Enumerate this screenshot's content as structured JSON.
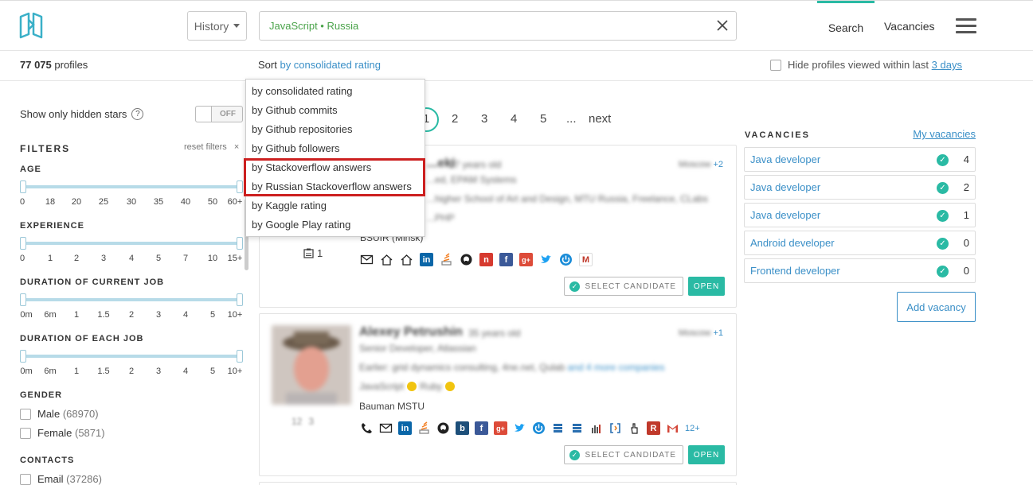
{
  "header": {
    "history_label": "History",
    "search_query": "JavaScript • Russia",
    "nav_search": "Search",
    "nav_vacancies": "Vacancies"
  },
  "subbar": {
    "profiles_count": "77 075",
    "profiles_label": "profiles",
    "sort_prefix": "Sort",
    "sort_value": "by consolidated rating",
    "hide_label": "Hide profiles viewed within last",
    "hide_days": "3 days"
  },
  "sort_menu": {
    "items": [
      "by consolidated rating",
      "by Github commits",
      "by Github repositories",
      "by Github followers",
      "by Stackoverflow answers",
      "by Russian Stackoverflow answers",
      "by Kaggle rating",
      "by Google Play rating"
    ],
    "highlight_color": "#cc1f1f"
  },
  "sidebar": {
    "hidden_stars_label": "Show only hidden stars",
    "help_glyph": "?",
    "toggle_label": "OFF",
    "filters_title": "FILTERS",
    "reset_label": "reset filters",
    "reset_close": "×",
    "age": {
      "title": "AGE",
      "ticks": [
        "0",
        "18",
        "20",
        "25",
        "30",
        "35",
        "40",
        "50",
        "60+"
      ]
    },
    "experience": {
      "title": "EXPERIENCE",
      "ticks": [
        "0",
        "1",
        "2",
        "3",
        "4",
        "5",
        "7",
        "10",
        "15+"
      ]
    },
    "current_job": {
      "title": "DURATION OF CURRENT JOB",
      "ticks": [
        "0m",
        "6m",
        "1",
        "1.5",
        "2",
        "3",
        "4",
        "5",
        "10+"
      ]
    },
    "each_job": {
      "title": "DURATION OF EACH JOB",
      "ticks": [
        "0m",
        "6m",
        "1",
        "1.5",
        "2",
        "3",
        "4",
        "5",
        "10+"
      ]
    },
    "gender": {
      "title": "GENDER",
      "options": [
        {
          "label": "Male",
          "count": "(68970)"
        },
        {
          "label": "Female",
          "count": "(5871)"
        }
      ]
    },
    "contacts": {
      "title": "CONTACTS",
      "options": [
        {
          "label": "Email",
          "count": "(37286)"
        }
      ]
    }
  },
  "pagination": {
    "current": "1",
    "pages": [
      "2",
      "3",
      "4",
      "5"
    ],
    "ellipsis": "...",
    "next": "next"
  },
  "cards": [
    {
      "name": "...eki",
      "age": "27 years old",
      "location": "Moscow",
      "location_more": "+2",
      "position": "...ed, EPAM Systems",
      "education": "...higher School of Art and Design, MTU Russia, Freelance, CLabs",
      "skills": "...PHP",
      "university": "BSUIR (Minsk)",
      "badge_count": "1",
      "select_label": "SELECT CANDIDATE",
      "open_label": "OPEN"
    },
    {
      "name": "Alexey Petrushin",
      "age": "35 years old",
      "location": "Moscow",
      "location_more": "+1",
      "position": "Senior Developer, Atlassian",
      "companies": "Earlier: grid dynamics consulting, 4ne.net, Qulab",
      "companies_more": "and 4 more companies",
      "skills_a": "JavaScript",
      "skills_b": "Ruby",
      "university": "Bauman MSTU",
      "stat_a": "12",
      "stat_b": "3",
      "more_icons": "12+",
      "select_label": "SELECT CANDIDATE",
      "open_label": "OPEN"
    }
  ],
  "vacancies": {
    "title": "VACANCIES",
    "my_link": "My vacancies",
    "items": [
      {
        "name": "Java developer",
        "count": "4"
      },
      {
        "name": "Java developer",
        "count": "2"
      },
      {
        "name": "Java developer",
        "count": "1"
      },
      {
        "name": "Android developer",
        "count": "0"
      },
      {
        "name": "Frontend developer",
        "count": "0"
      }
    ],
    "add_label": "Add vacancy"
  },
  "colors": {
    "accent": "#2abaa4",
    "link": "#3a8fc7",
    "query_green": "#4aa34a"
  }
}
